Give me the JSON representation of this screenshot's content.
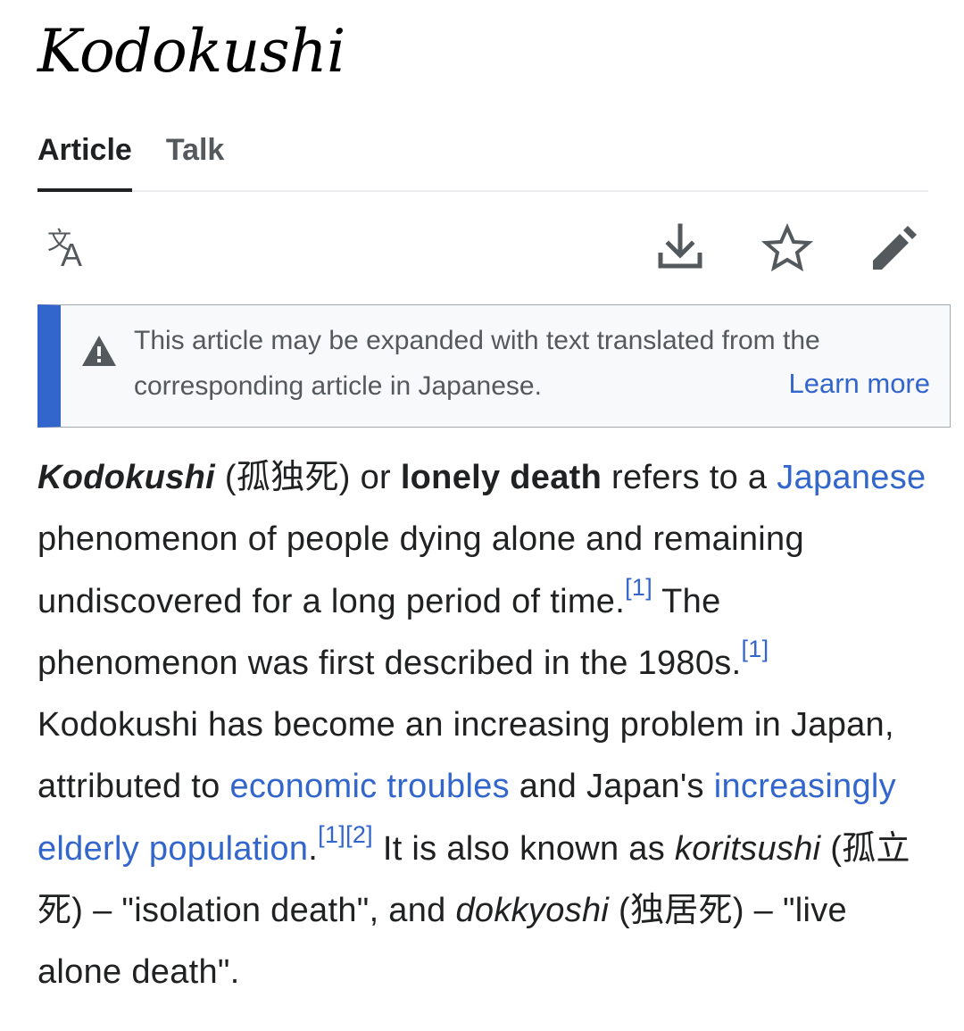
{
  "page": {
    "title": "Kodokushi"
  },
  "tabs": [
    {
      "label": "Article",
      "active": true
    },
    {
      "label": "Talk",
      "active": false
    }
  ],
  "toolbar": {
    "icons": [
      "language-icon",
      "download-icon",
      "star-icon",
      "edit-icon"
    ]
  },
  "notice": {
    "message": "This article may be expanded with text translated from the corresponding article in Japanese.",
    "link": "Learn more",
    "accent_color": "#3366cc"
  },
  "article": {
    "term": "Kodokushi",
    "kanji1": "(孤独死)",
    "or": "or",
    "bold_term": "lonely death",
    "refers": "refers to a",
    "link_japanese": "Japanese",
    "s1_rest": "phenomenon of people dying alone and remaining undiscovered for a long period of time.",
    "ref1a": "[1]",
    "s2": "The phenomenon was first described in the 1980s.",
    "ref1b": "[1]",
    "s3_start": "Kodokushi has become an increasing problem in Japan, attributed to",
    "link_economic": "economic troubles",
    "s3_mid": "and Japan's",
    "link_elderly": "increasingly elderly population",
    "period": ".",
    "ref1c": "[1]",
    "ref2": "[2]",
    "s4_start": "It is also known as",
    "koritsushi": "koritsushi",
    "kanji2": "(孤立死)",
    "s4_mid": "– \"isolation death\", and",
    "dokkyoshi": "dokkyoshi",
    "kanji3": "(独居死)",
    "s4_end": "– \"live alone death\"."
  },
  "colors": {
    "link": "#3366cc",
    "text": "#202122",
    "muted": "#54595d"
  }
}
